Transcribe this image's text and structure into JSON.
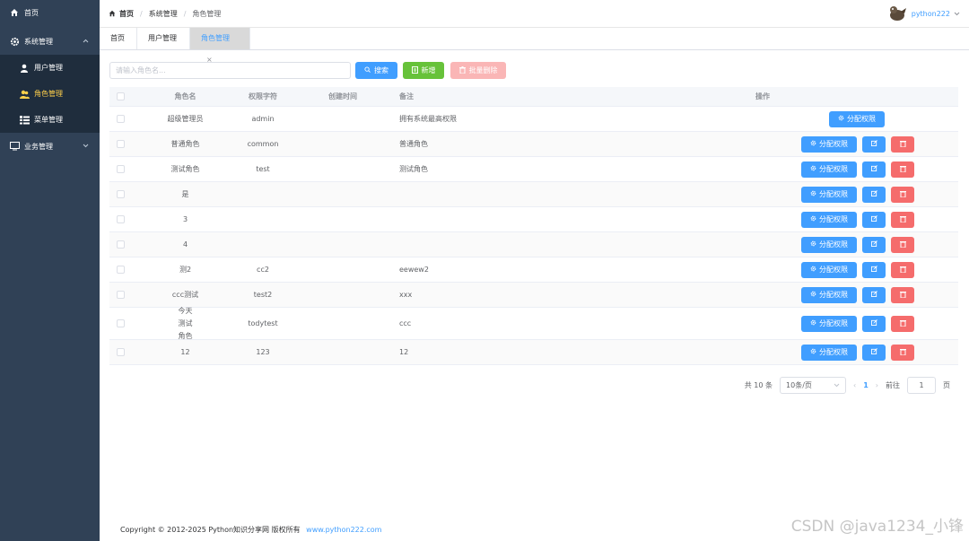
{
  "sidebar": {
    "items": [
      {
        "label": "首页",
        "icon": "home-icon"
      },
      {
        "label": "系统管理",
        "icon": "gear-icon"
      },
      {
        "label": "用户管理",
        "icon": "user-icon"
      },
      {
        "label": "角色管理",
        "icon": "users-icon"
      },
      {
        "label": "菜单管理",
        "icon": "menu-list-icon"
      },
      {
        "label": "业务管理",
        "icon": "monitor-icon"
      }
    ]
  },
  "header": {
    "breadcrumb": [
      "首页",
      "系统管理",
      "角色管理"
    ],
    "username": "python222"
  },
  "tabs": [
    {
      "label": "首页"
    },
    {
      "label": "用户管理"
    },
    {
      "label": "角色管理"
    }
  ],
  "toolbar": {
    "search_placeholder": "请输入角色名...",
    "search_label": "搜索",
    "add_label": "新增",
    "batch_delete_label": "批量删除"
  },
  "table": {
    "headers": {
      "name": "角色名",
      "key": "权限字符",
      "time": "创建时间",
      "remark": "备注",
      "ops": "操作"
    },
    "assign_label": "分配权限",
    "rows": [
      {
        "name": "超级管理员",
        "key": "admin",
        "time": "",
        "remark": "拥有系统最高权限"
      },
      {
        "name": "普通角色",
        "key": "common",
        "time": "",
        "remark": "普通角色"
      },
      {
        "name": "测试角色",
        "key": "test",
        "time": "",
        "remark": "测试角色"
      },
      {
        "name": "是",
        "key": "",
        "time": "",
        "remark": ""
      },
      {
        "name": "3",
        "key": "",
        "time": "",
        "remark": ""
      },
      {
        "name": "4",
        "key": "",
        "time": "",
        "remark": ""
      },
      {
        "name": "测2",
        "key": "cc2",
        "time": "",
        "remark": "eewew2"
      },
      {
        "name": "ccc测试",
        "key": "test2",
        "time": "",
        "remark": "xxx"
      },
      {
        "name": "今天测试角色",
        "key": "todytest",
        "time": "",
        "remark": "ccc"
      },
      {
        "name": "12",
        "key": "123",
        "time": "",
        "remark": "12"
      }
    ]
  },
  "pagination": {
    "total_label": "共 10 条",
    "page_size": "10条/页",
    "current_page": "1",
    "goto_label": "前往",
    "goto_value": "1",
    "page_suffix": "页"
  },
  "footer": {
    "copyright": "Copyright © 2012-2025 Python知识分享网 版权所有",
    "link": "www.python222.com"
  },
  "watermark": "CSDN @java1234_小锋",
  "colors": {
    "sidebar": "#304156",
    "primary": "#409eff",
    "success": "#67c23a",
    "danger": "#f56c6c",
    "active_menu": "#ffd04b"
  }
}
